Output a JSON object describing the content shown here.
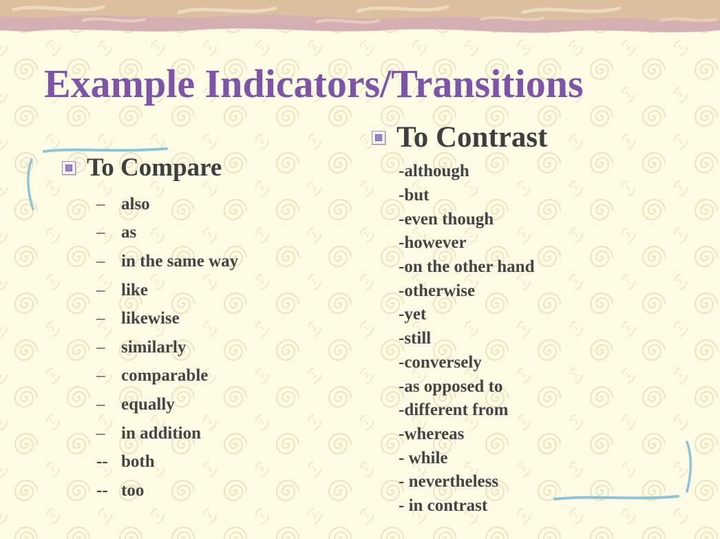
{
  "slide": {
    "title": "Example Indicators/Transitions",
    "compare": {
      "heading": "To Compare",
      "items": [
        {
          "marker": "–",
          "text": "also"
        },
        {
          "marker": "–",
          "text": "as"
        },
        {
          "marker": "–",
          "text": "in the same way"
        },
        {
          "marker": "–",
          "text": "like"
        },
        {
          "marker": "–",
          "text": "likewise"
        },
        {
          "marker": "–",
          "text": "similarly"
        },
        {
          "marker": "–",
          "text": "comparable"
        },
        {
          "marker": "–",
          "text": "equally"
        },
        {
          "marker": "–",
          "text": "in addition"
        },
        {
          "marker": "--",
          "text": "both"
        },
        {
          "marker": "--",
          "text": "too"
        }
      ]
    },
    "contrast": {
      "heading": "To Contrast",
      "items": [
        "-although",
        "-but",
        "-even though",
        "-however",
        "-on the other hand",
        "-otherwise",
        "-yet",
        "-still",
        "-conversely",
        "-as opposed to",
        "-different from",
        "-whereas",
        "- while",
        "- nevertheless",
        "- in contrast"
      ]
    }
  },
  "colors": {
    "background": "#fdfbe4",
    "title": "#7d55a8",
    "text": "#444444",
    "band": "#cfa7b0",
    "swirl": "#ece4c4",
    "accent_line": "#8fc3d8",
    "bullet": "#9a83c6"
  },
  "icons": {
    "bullet": "square-bullet-icon"
  }
}
